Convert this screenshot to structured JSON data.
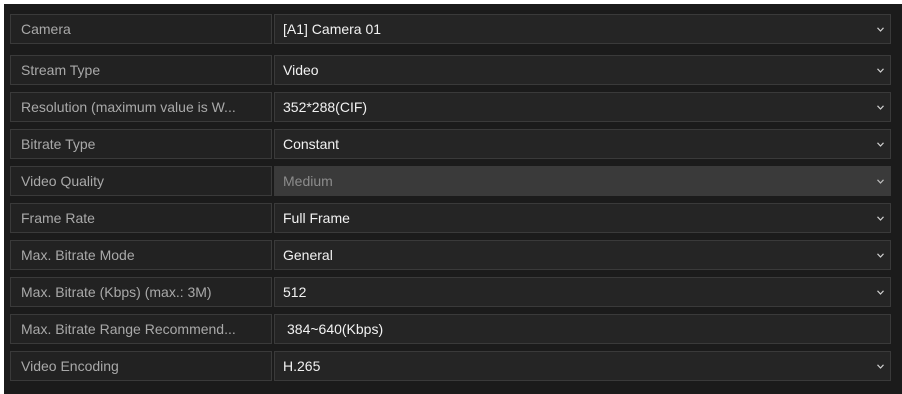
{
  "camera": {
    "label": "Camera",
    "value": "[A1] Camera 01"
  },
  "settings": [
    {
      "label": "Stream Type",
      "value": "Video",
      "dropdown": true,
      "disabled": false
    },
    {
      "label": "Resolution (maximum value is W...",
      "value": "352*288(CIF)",
      "dropdown": true,
      "disabled": false
    },
    {
      "label": "Bitrate Type",
      "value": "Constant",
      "dropdown": true,
      "disabled": false
    },
    {
      "label": "Video Quality",
      "value": "Medium",
      "dropdown": true,
      "disabled": true
    },
    {
      "label": "Frame Rate",
      "value": "Full Frame",
      "dropdown": true,
      "disabled": false
    },
    {
      "label": "Max. Bitrate Mode",
      "value": "General",
      "dropdown": true,
      "disabled": false
    },
    {
      "label": "Max. Bitrate (Kbps) (max.: 3M)",
      "value": "512",
      "dropdown": true,
      "disabled": false
    },
    {
      "label": "Max. Bitrate Range Recommend...",
      "value": "384~640(Kbps)",
      "dropdown": false,
      "disabled": false
    },
    {
      "label": "Video Encoding",
      "value": "H.265",
      "dropdown": true,
      "disabled": false
    }
  ],
  "icons": {
    "dropdown": "chevron-down-icon"
  },
  "colors": {
    "panel_bg": "#1b1b1b",
    "cell_bg": "#252525",
    "disabled_bg": "#3a3a3a",
    "label_text": "#a9a9a9",
    "value_text": "#f2f2f2"
  }
}
